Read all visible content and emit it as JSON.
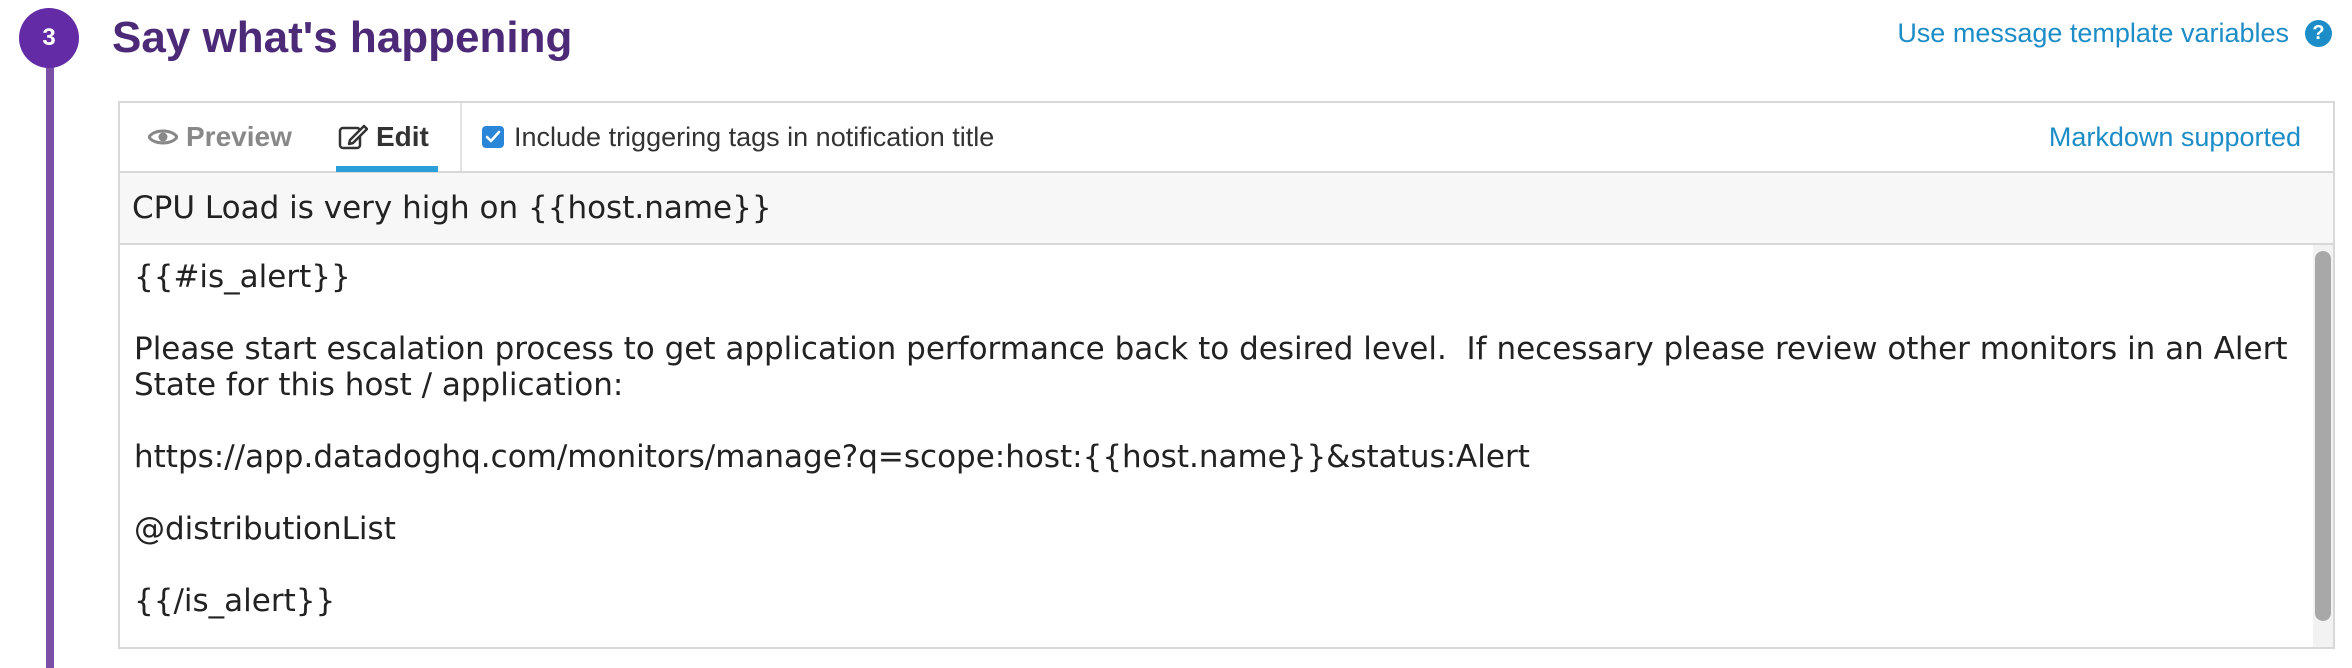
{
  "step": {
    "number": "3",
    "title": "Say what's happening"
  },
  "links": {
    "template_variables": "Use message template variables",
    "help_icon": "?"
  },
  "toolbar": {
    "tabs": [
      {
        "label": "Preview",
        "icon": "eye-icon",
        "active": false
      },
      {
        "label": "Edit",
        "icon": "edit-icon",
        "active": true
      }
    ],
    "checkbox": {
      "label": "Include triggering tags in notification title",
      "checked": true
    },
    "markdown_label": "Markdown supported"
  },
  "message": {
    "title": "CPU Load is very high on {{host.name}}",
    "body_lines": [
      "{{#is_alert}}",
      "",
      "Please start escalation process to get application performance back to desired level.  If necessary please review other monitors in an Alert State for this host / application:",
      "",
      "https://app.datadoghq.com/monitors/manage?q=scope:host:{{host.name}}&status:Alert",
      "",
      "@distributionList",
      "",
      "{{/is_alert}}"
    ]
  },
  "colors": {
    "step_accent": "#632ca6",
    "link": "#1d8dc7",
    "tab_active_underline": "#2a9fd8"
  }
}
